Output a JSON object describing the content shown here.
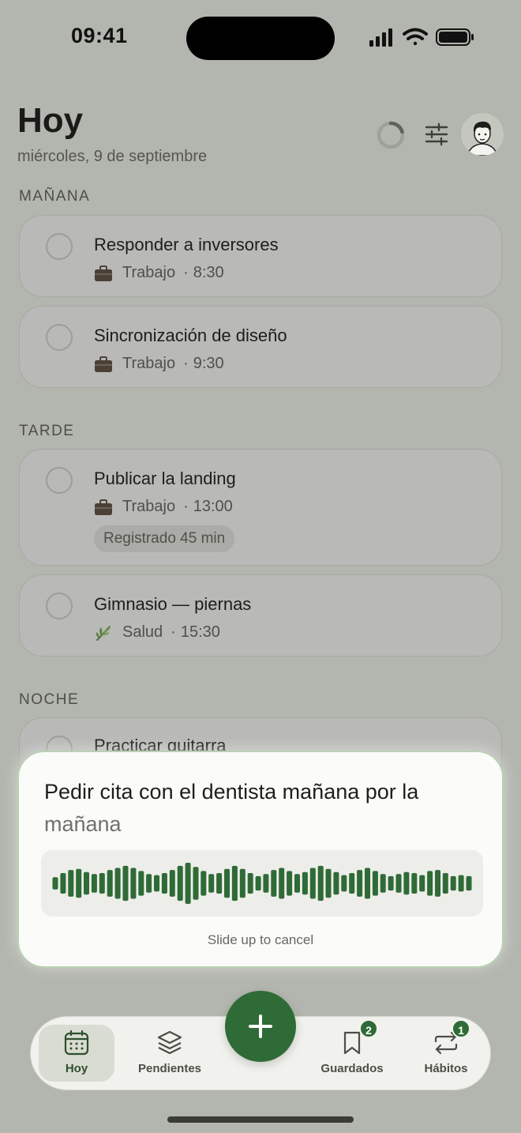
{
  "status_bar": {
    "time": "09:41"
  },
  "header": {
    "title": "Hoy",
    "date": "miércoles, 9 de septiembre"
  },
  "sections": [
    {
      "label": "MAÑANA",
      "tasks": [
        {
          "title": "Responder a inversores",
          "category": "Trabajo",
          "category_icon": "briefcase-icon",
          "time": "8:30"
        },
        {
          "title": "Sincronización de diseño",
          "category": "Trabajo",
          "category_icon": "briefcase-icon",
          "time": "9:30"
        }
      ]
    },
    {
      "label": "TARDE",
      "tasks": [
        {
          "title": "Publicar la landing",
          "category": "Trabajo",
          "category_icon": "briefcase-icon",
          "time": "13:00",
          "logged": "Registrado 45 min"
        },
        {
          "title": "Gimnasio — piernas",
          "category": "Salud",
          "category_icon": "herb-icon",
          "time": "15:30"
        }
      ]
    },
    {
      "label": "NOCHE",
      "tasks": [
        {
          "title": "Practicar guitarra"
        }
      ]
    }
  ],
  "voice_input": {
    "transcript_confirmed": "Pedir cita con el dentista mañana por la ",
    "transcript_pending": "mañana",
    "hint": "Slide up to cancel",
    "waveform_levels": [
      0.3,
      0.5,
      0.65,
      0.7,
      0.55,
      0.45,
      0.5,
      0.65,
      0.75,
      0.85,
      0.75,
      0.6,
      0.45,
      0.4,
      0.5,
      0.65,
      0.85,
      1.0,
      0.8,
      0.6,
      0.45,
      0.5,
      0.7,
      0.85,
      0.7,
      0.5,
      0.35,
      0.45,
      0.65,
      0.75,
      0.6,
      0.45,
      0.55,
      0.75,
      0.85,
      0.7,
      0.55,
      0.4,
      0.5,
      0.65,
      0.75,
      0.6,
      0.45,
      0.35,
      0.45,
      0.55,
      0.5,
      0.4,
      0.6,
      0.65,
      0.5,
      0.35,
      0.4,
      0.35
    ],
    "accent_color": "#2f6b36"
  },
  "tab_bar": {
    "items": [
      {
        "label": "Hoy",
        "icon": "calendar-icon",
        "active": true
      },
      {
        "label": "Pendientes",
        "icon": "layers-icon"
      },
      {
        "label": "Guardados",
        "icon": "bookmark-icon",
        "badge": "2"
      },
      {
        "label": "Hábitos",
        "icon": "repeat-icon",
        "badge": "1"
      }
    ],
    "fab_icon": "plus-icon"
  },
  "colors": {
    "brand_green": "#2f6b36",
    "background": "#b3b6ae"
  }
}
